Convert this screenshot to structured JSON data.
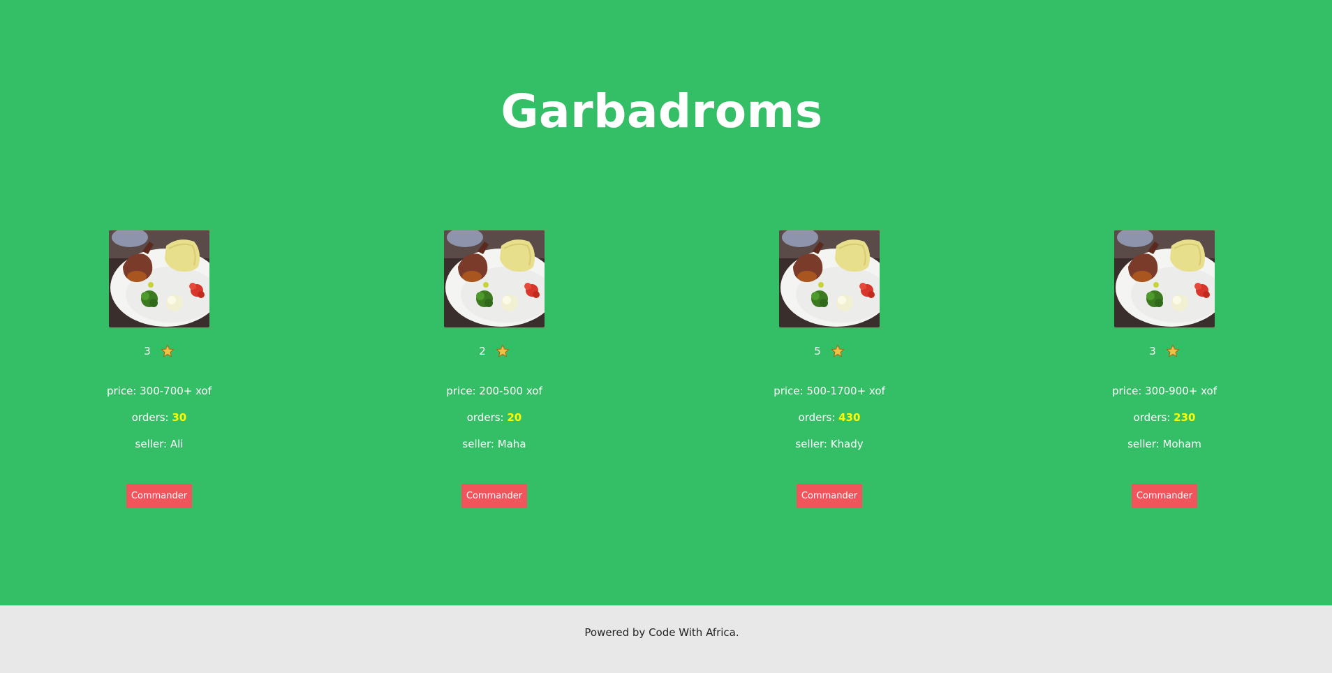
{
  "header": {
    "title": "Garbadroms"
  },
  "currency_note": "",
  "cards": [
    {
      "rating": "3",
      "price": "price: 300-700+ xof",
      "orders_label": "orders: ",
      "orders": "30",
      "seller": "seller: Ali",
      "button": "Commander",
      "image_icon": "food-plate-image",
      "star_icon": "star-icon"
    },
    {
      "rating": "2",
      "price": "price: 200-500 xof",
      "orders_label": "orders: ",
      "orders": "20",
      "seller": "seller: Maha",
      "button": "Commander",
      "image_icon": "food-plate-image",
      "star_icon": "star-icon"
    },
    {
      "rating": "5",
      "price": "price: 500-1700+ xof",
      "orders_label": "orders: ",
      "orders": "430",
      "seller": "seller: Khady",
      "button": "Commander",
      "image_icon": "food-plate-image",
      "star_icon": "star-icon"
    },
    {
      "rating": "3",
      "price": "price: 300-900+ xof",
      "orders_label": "orders: ",
      "orders": "230",
      "seller": "seller: Moham",
      "button": "Commander",
      "image_icon": "food-plate-image",
      "star_icon": "star-icon"
    }
  ],
  "footer": {
    "text": "Powered by Code With Africa."
  },
  "colors": {
    "hero_background": "#34bf66",
    "footer_background": "#e8e8e8",
    "button_background": "#f2545b",
    "orders_highlight": "#ffff00",
    "star": "#f5c04a"
  }
}
